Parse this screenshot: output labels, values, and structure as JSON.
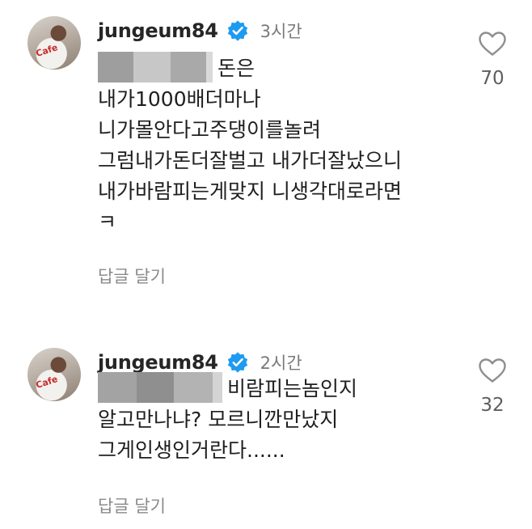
{
  "comments": [
    {
      "username": "jungeum84",
      "time": "3시간",
      "lines": [
        "돈은",
        "내가1000배더마나",
        "니가몰안다고주댕이를놀려",
        "그럼내가돈더잘벌고 내가더잘났으니",
        "내가바람피는게맞지 니생각대로라면",
        "ㅋ"
      ],
      "reply_label": "답글 달기",
      "like_count": "70",
      "avatar_cup_text": "Cafe"
    },
    {
      "username": "jungeum84",
      "time": "2시간",
      "lines": [
        "비람피는놈인지",
        "알고만나냐? 모르니깐만났지",
        "그게인생인거란다......"
      ],
      "reply_label": "답글 달기",
      "like_count": "32",
      "avatar_cup_text": "Cafe"
    }
  ],
  "icons": {
    "verified": "verified-badge-icon",
    "like": "heart-outline-icon"
  },
  "colors": {
    "verified_blue": "#1d9bf0",
    "username": "#262626",
    "meta_gray": "#8a8a8a"
  }
}
